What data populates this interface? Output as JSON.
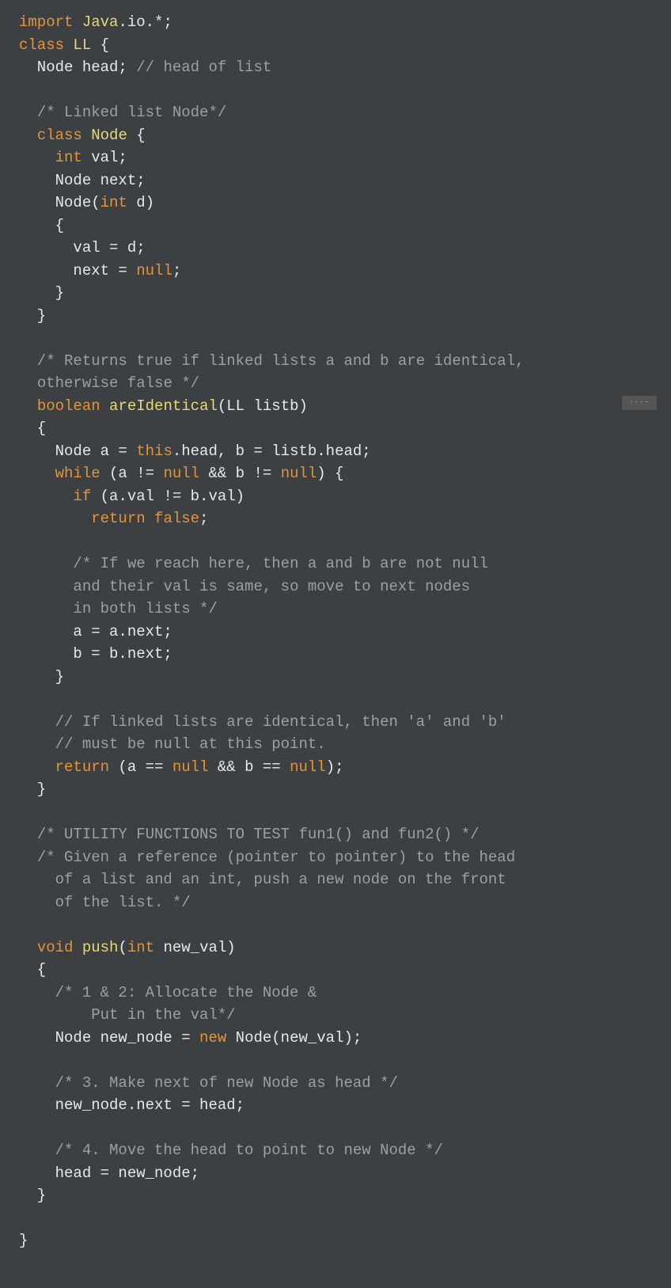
{
  "minimap_hint": "·---",
  "lines": [
    [
      {
        "c": "kw",
        "t": "import"
      },
      {
        "c": "plain",
        "t": " "
      },
      {
        "c": "type",
        "t": "Java"
      },
      {
        "c": "plain",
        "t": ".io.*;"
      }
    ],
    [
      {
        "c": "kw",
        "t": "class"
      },
      {
        "c": "plain",
        "t": " "
      },
      {
        "c": "type",
        "t": "LL"
      },
      {
        "c": "plain",
        "t": " {"
      }
    ],
    [
      {
        "c": "plain",
        "t": "  Node head; "
      },
      {
        "c": "comment",
        "t": "// head of list"
      }
    ],
    [
      {
        "c": "plain",
        "t": ""
      }
    ],
    [
      {
        "c": "plain",
        "t": "  "
      },
      {
        "c": "comment",
        "t": "/* Linked list Node*/"
      }
    ],
    [
      {
        "c": "plain",
        "t": "  "
      },
      {
        "c": "kw",
        "t": "class"
      },
      {
        "c": "plain",
        "t": " "
      },
      {
        "c": "type",
        "t": "Node"
      },
      {
        "c": "plain",
        "t": " {"
      }
    ],
    [
      {
        "c": "plain",
        "t": "    "
      },
      {
        "c": "kw",
        "t": "int"
      },
      {
        "c": "plain",
        "t": " val;"
      }
    ],
    [
      {
        "c": "plain",
        "t": "    Node next;"
      }
    ],
    [
      {
        "c": "plain",
        "t": "    Node("
      },
      {
        "c": "kw",
        "t": "int"
      },
      {
        "c": "plain",
        "t": " d)"
      }
    ],
    [
      {
        "c": "plain",
        "t": "    {"
      }
    ],
    [
      {
        "c": "plain",
        "t": "      val = d;"
      }
    ],
    [
      {
        "c": "plain",
        "t": "      next = "
      },
      {
        "c": "kw",
        "t": "null"
      },
      {
        "c": "plain",
        "t": ";"
      }
    ],
    [
      {
        "c": "plain",
        "t": "    }"
      }
    ],
    [
      {
        "c": "plain",
        "t": "  }"
      }
    ],
    [
      {
        "c": "plain",
        "t": ""
      }
    ],
    [
      {
        "c": "plain",
        "t": "  "
      },
      {
        "c": "comment",
        "t": "/* Returns true if linked lists a and b are identical,"
      }
    ],
    [
      {
        "c": "plain",
        "t": "  "
      },
      {
        "c": "comment",
        "t": "otherwise false */"
      }
    ],
    [
      {
        "c": "plain",
        "t": "  "
      },
      {
        "c": "kw",
        "t": "boolean"
      },
      {
        "c": "plain",
        "t": " "
      },
      {
        "c": "type",
        "t": "areIdentical"
      },
      {
        "c": "plain",
        "t": "(LL listb)"
      }
    ],
    [
      {
        "c": "plain",
        "t": "  {"
      }
    ],
    [
      {
        "c": "plain",
        "t": "    Node a = "
      },
      {
        "c": "kw",
        "t": "this"
      },
      {
        "c": "plain",
        "t": ".head, b = listb.head;"
      }
    ],
    [
      {
        "c": "plain",
        "t": "    "
      },
      {
        "c": "kw",
        "t": "while"
      },
      {
        "c": "plain",
        "t": " (a != "
      },
      {
        "c": "kw",
        "t": "null"
      },
      {
        "c": "plain",
        "t": " && b != "
      },
      {
        "c": "kw",
        "t": "null"
      },
      {
        "c": "plain",
        "t": ") {"
      }
    ],
    [
      {
        "c": "plain",
        "t": "      "
      },
      {
        "c": "kw",
        "t": "if"
      },
      {
        "c": "plain",
        "t": " (a.val != b.val)"
      }
    ],
    [
      {
        "c": "plain",
        "t": "        "
      },
      {
        "c": "kw",
        "t": "return"
      },
      {
        "c": "plain",
        "t": " "
      },
      {
        "c": "kw",
        "t": "false"
      },
      {
        "c": "plain",
        "t": ";"
      }
    ],
    [
      {
        "c": "plain",
        "t": ""
      }
    ],
    [
      {
        "c": "plain",
        "t": "      "
      },
      {
        "c": "comment",
        "t": "/* If we reach here, then a and b are not null"
      }
    ],
    [
      {
        "c": "plain",
        "t": "      "
      },
      {
        "c": "comment",
        "t": "and their val is same, so move to next nodes"
      }
    ],
    [
      {
        "c": "plain",
        "t": "      "
      },
      {
        "c": "comment",
        "t": "in both lists */"
      }
    ],
    [
      {
        "c": "plain",
        "t": "      a = a.next;"
      }
    ],
    [
      {
        "c": "plain",
        "t": "      b = b.next;"
      }
    ],
    [
      {
        "c": "plain",
        "t": "    }"
      }
    ],
    [
      {
        "c": "plain",
        "t": ""
      }
    ],
    [
      {
        "c": "plain",
        "t": "    "
      },
      {
        "c": "comment",
        "t": "// If linked lists are identical, then 'a' and 'b'"
      }
    ],
    [
      {
        "c": "plain",
        "t": "    "
      },
      {
        "c": "comment",
        "t": "// must be null at this point."
      }
    ],
    [
      {
        "c": "plain",
        "t": "    "
      },
      {
        "c": "kw",
        "t": "return"
      },
      {
        "c": "plain",
        "t": " (a == "
      },
      {
        "c": "kw",
        "t": "null"
      },
      {
        "c": "plain",
        "t": " && b == "
      },
      {
        "c": "kw",
        "t": "null"
      },
      {
        "c": "plain",
        "t": ");"
      }
    ],
    [
      {
        "c": "plain",
        "t": "  }"
      }
    ],
    [
      {
        "c": "plain",
        "t": ""
      }
    ],
    [
      {
        "c": "plain",
        "t": "  "
      },
      {
        "c": "comment",
        "t": "/* UTILITY FUNCTIONS TO TEST fun1() and fun2() */"
      }
    ],
    [
      {
        "c": "plain",
        "t": "  "
      },
      {
        "c": "comment",
        "t": "/* Given a reference (pointer to pointer) to the head"
      }
    ],
    [
      {
        "c": "plain",
        "t": "    "
      },
      {
        "c": "comment",
        "t": "of a list and an int, push a new node on the front"
      }
    ],
    [
      {
        "c": "plain",
        "t": "    "
      },
      {
        "c": "comment",
        "t": "of the list. */"
      }
    ],
    [
      {
        "c": "plain",
        "t": ""
      }
    ],
    [
      {
        "c": "plain",
        "t": "  "
      },
      {
        "c": "kw",
        "t": "void"
      },
      {
        "c": "plain",
        "t": " "
      },
      {
        "c": "type",
        "t": "push"
      },
      {
        "c": "plain",
        "t": "("
      },
      {
        "c": "kw",
        "t": "int"
      },
      {
        "c": "plain",
        "t": " new_val)"
      }
    ],
    [
      {
        "c": "plain",
        "t": "  {"
      }
    ],
    [
      {
        "c": "plain",
        "t": "    "
      },
      {
        "c": "comment",
        "t": "/* 1 & 2: Allocate the Node &"
      }
    ],
    [
      {
        "c": "plain",
        "t": "        "
      },
      {
        "c": "comment",
        "t": "Put in the val*/"
      }
    ],
    [
      {
        "c": "plain",
        "t": "    Node new_node = "
      },
      {
        "c": "kw",
        "t": "new"
      },
      {
        "c": "plain",
        "t": " Node(new_val);"
      }
    ],
    [
      {
        "c": "plain",
        "t": ""
      }
    ],
    [
      {
        "c": "plain",
        "t": "    "
      },
      {
        "c": "comment",
        "t": "/* 3. Make next of new Node as head */"
      }
    ],
    [
      {
        "c": "plain",
        "t": "    new_node.next = head;"
      }
    ],
    [
      {
        "c": "plain",
        "t": ""
      }
    ],
    [
      {
        "c": "plain",
        "t": "    "
      },
      {
        "c": "comment",
        "t": "/* 4. Move the head to point to new Node */"
      }
    ],
    [
      {
        "c": "plain",
        "t": "    head = new_node;"
      }
    ],
    [
      {
        "c": "plain",
        "t": "  }"
      }
    ],
    [
      {
        "c": "plain",
        "t": ""
      }
    ],
    [
      {
        "c": "plain",
        "t": "}"
      }
    ]
  ]
}
